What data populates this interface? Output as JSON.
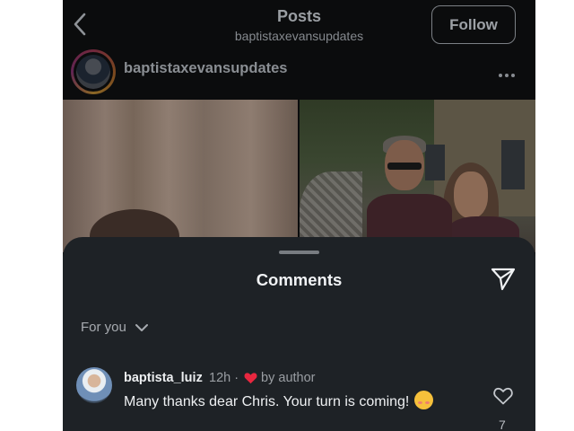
{
  "header": {
    "title": "Posts",
    "subtitle": "baptistaxevansupdates",
    "follow_label": "Follow"
  },
  "post": {
    "author": "baptistaxevansupdates"
  },
  "comments_sheet": {
    "title": "Comments",
    "filter_label": "For you"
  },
  "comment": {
    "username": "baptista_luiz",
    "time": "12h",
    "separator": "·",
    "liked_by": "by author",
    "text": "Many thanks dear Chris. Your turn is coming!",
    "like_count": "7"
  },
  "colors": {
    "background": "#0b0c0d",
    "sheet": "#1e2226",
    "heart": "#e8273f",
    "emoji": "#f6c03b"
  },
  "icons": {
    "back": "chevron-left-icon",
    "more": "more-horizontal-icon",
    "share": "paper-plane-icon",
    "filter": "chevron-down-icon",
    "author_like": "heart-filled-icon",
    "like": "heart-outline-icon"
  }
}
